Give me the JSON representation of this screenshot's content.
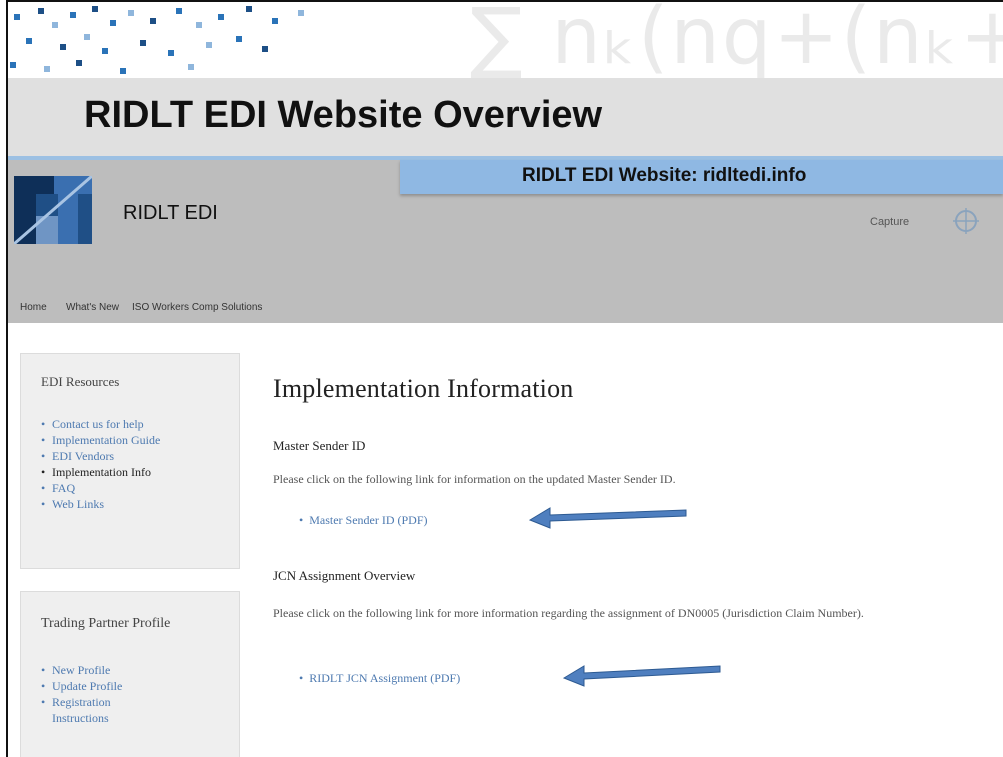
{
  "slide": {
    "title": "RIDLT EDI Website Overview",
    "watermark_formula": "∑ nₖ(nq+(nₖ+mₖ"
  },
  "callout": {
    "text": "RIDLT EDI Website: ridltedi.info"
  },
  "site": {
    "name": "RIDLT EDI",
    "capture_label": "Capture",
    "nav": [
      "Home",
      "What's New",
      "ISO Workers Comp Solutions"
    ]
  },
  "sidebar": {
    "resources": {
      "title": "EDI Resources",
      "items": [
        "Contact us for help",
        "Implementation Guide",
        "EDI Vendors",
        "Implementation Info",
        "FAQ",
        "Web Links"
      ]
    },
    "trading_partner": {
      "title": "Trading Partner Profile",
      "items": [
        "New Profile",
        "Update Profile",
        "Registration Instructions"
      ]
    }
  },
  "main": {
    "heading": "Implementation Information",
    "sections": [
      {
        "title": "Master Sender ID",
        "text": "Please click on the following link for information on the updated Master Sender ID.",
        "link": "Master Sender ID (PDF)"
      },
      {
        "title": "JCN Assignment Overview",
        "text": "Please click on the following link for more information regarding the assignment of DN0005 (Jurisdiction Claim Number).",
        "link": "RIDLT JCN Assignment (PDF)"
      }
    ]
  },
  "colors": {
    "accent_blue": "#2a73b8",
    "callout_blue": "#8fb8e3",
    "link_blue": "#4e7ab0",
    "header_grey": "#bdbdbd"
  }
}
